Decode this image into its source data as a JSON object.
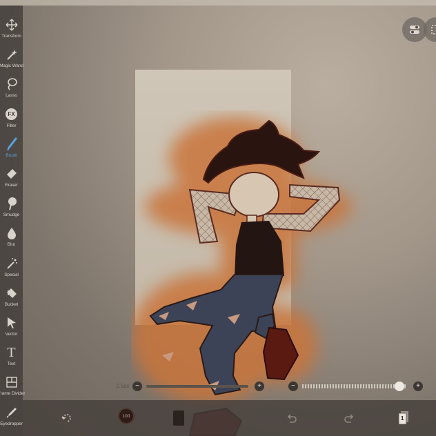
{
  "toolbar": {
    "tools": [
      {
        "label": "Transform",
        "icon": "move-arrows-icon"
      },
      {
        "label": "Magic Wand",
        "icon": "magic-wand-icon"
      },
      {
        "label": "Lasso",
        "icon": "lasso-icon"
      },
      {
        "label": "Filter",
        "icon": "fx-icon",
        "glyph": "FX"
      },
      {
        "label": "Brush",
        "icon": "brush-icon",
        "active": true
      },
      {
        "label": "Eraser",
        "icon": "eraser-icon"
      },
      {
        "label": "Smudge",
        "icon": "smudge-icon"
      },
      {
        "label": "Blur",
        "icon": "droplet-icon"
      },
      {
        "label": "Special",
        "icon": "sparkle-wand-icon"
      },
      {
        "label": "Bucket",
        "icon": "bucket-icon"
      },
      {
        "label": "Vector",
        "icon": "cursor-arrow-icon"
      },
      {
        "label": "Text",
        "icon": "text-t-icon",
        "glyph": "T"
      },
      {
        "label": "Frame Divider",
        "icon": "frame-divider-icon"
      },
      {
        "label": "Eyedropper",
        "icon": "eyedropper-icon"
      }
    ]
  },
  "brush": {
    "size_label": "2.5px",
    "minus": "−",
    "plus": "+",
    "opacity": 0.93
  },
  "bottom_bar": {
    "color_label": "100",
    "layer_count": "1"
  },
  "colors": {
    "active_tool": "#5aa3e0",
    "glow": "#c9753a",
    "hair": "#2a1410",
    "shirt": "#231612",
    "jeans": "#3c4356",
    "shoe": "#5a1a12"
  }
}
